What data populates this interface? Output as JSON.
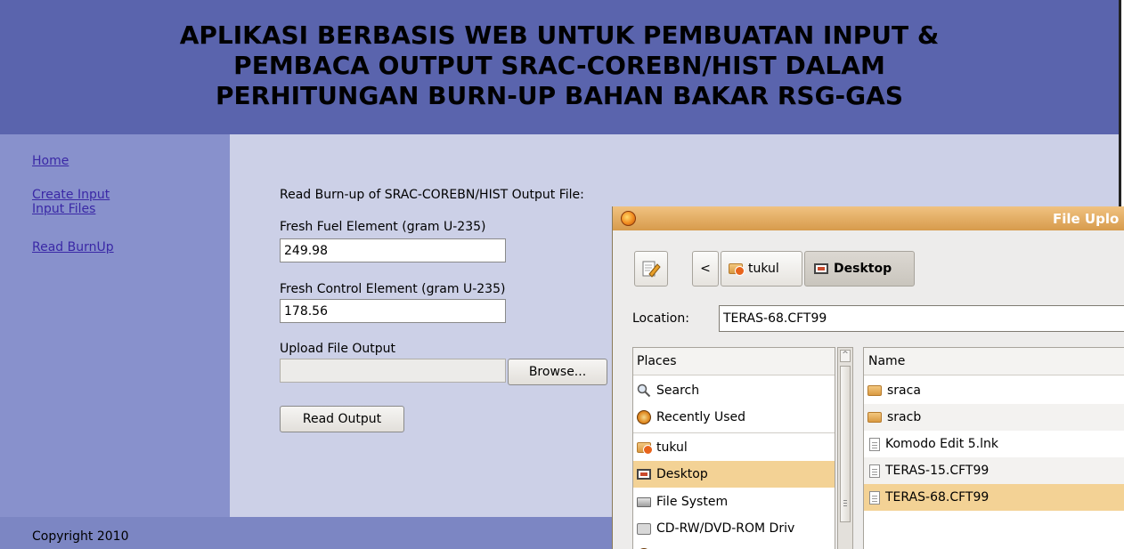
{
  "header": {
    "title_line1": "APLIKASI BERBASIS WEB UNTUK PEMBUATAN INPUT &",
    "title_line2": "PEMBACA OUTPUT SRAC-COREBN/HIST DALAM",
    "title_line3": "PERHITUNGAN BURN-UP BAHAN BAKAR RSG-GAS"
  },
  "nav": {
    "home": "Home",
    "create_input_line1": "Create Input",
    "create_input_line2": "Input Files",
    "read_burnup": "Read BurnUp"
  },
  "form": {
    "heading": "Read Burn-up of SRAC-COREBN/HIST Output File:",
    "fuel_label": "Fresh Fuel Element (gram U-235)",
    "fuel_value": "249.98",
    "control_label": "Fresh Control Element (gram U-235)",
    "control_value": "178.56",
    "upload_label": "Upload File Output",
    "upload_value": "",
    "browse_label": "Browse...",
    "submit_label": "Read Output"
  },
  "footer": {
    "copyright": "Copyright 2010"
  },
  "dialog": {
    "title": "File Uplo",
    "path_back": "<",
    "path_tukul": "tukul",
    "path_desktop": "Desktop",
    "location_label": "Location:",
    "location_value": "TERAS-68.CFT99",
    "places_header": "Places",
    "places": [
      {
        "label": "Search",
        "icon": "search-icon"
      },
      {
        "label": "Recently Used",
        "icon": "recently-used-icon"
      },
      {
        "label": "tukul",
        "icon": "home-folder-icon"
      },
      {
        "label": "Desktop",
        "icon": "desktop-icon"
      },
      {
        "label": "File System",
        "icon": "drive-icon"
      },
      {
        "label": "CD-RW/DVD-ROM Driv",
        "icon": "cd-drive-icon"
      }
    ],
    "name_header": "Name",
    "files": [
      {
        "label": "sraca",
        "icon": "folder-icon"
      },
      {
        "label": "sracb",
        "icon": "folder-icon"
      },
      {
        "label": "Komodo Edit 5.lnk",
        "icon": "file-icon"
      },
      {
        "label": "TERAS-15.CFT99",
        "icon": "file-icon"
      },
      {
        "label": "TERAS-68.CFT99",
        "icon": "file-icon"
      }
    ],
    "selected_color": "#f3d295"
  }
}
